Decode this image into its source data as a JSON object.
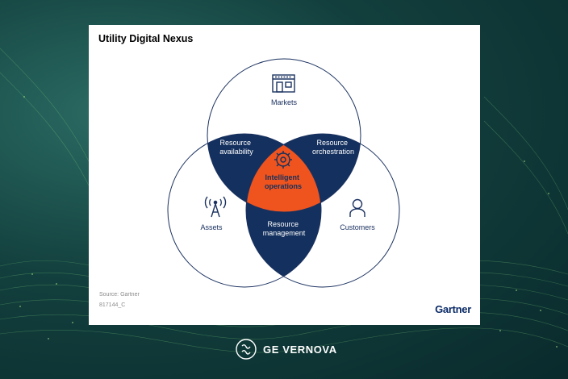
{
  "title": "Utility Digital Nexus",
  "diagram": {
    "circles": [
      {
        "label": "Markets",
        "icon": "storefront-icon"
      },
      {
        "label": "Assets",
        "icon": "transmission-tower-icon"
      },
      {
        "label": "Customers",
        "icon": "person-icon"
      }
    ],
    "intersections": {
      "markets_assets": [
        "Resource",
        "availability"
      ],
      "markets_customers": [
        "Resource",
        "orchestration"
      ],
      "assets_customers": [
        "Resource",
        "management"
      ],
      "center": [
        "Intelligent",
        "operations"
      ],
      "center_icon": "gear-circuit-icon"
    },
    "colors": {
      "intersection": "#13305e",
      "center": "#f0541e",
      "outline": "#1b3260"
    }
  },
  "footer": {
    "source": "Source: Gartner",
    "code": "817144_C",
    "brand": "Gartner"
  },
  "ge": {
    "brand": "GE VERNOVA"
  }
}
